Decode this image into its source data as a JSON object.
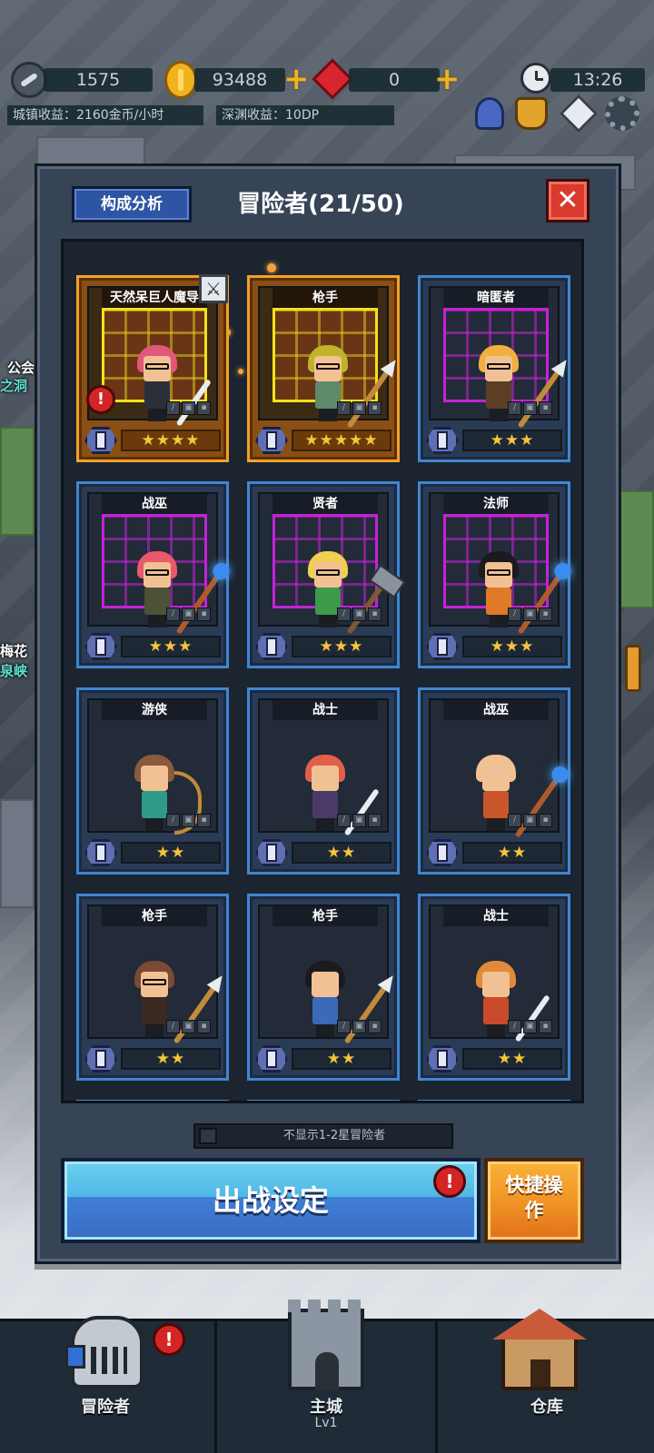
{
  "hud": {
    "emblem_value": "1575",
    "gold_value": "93488",
    "gem_value": "0",
    "clock_time": "13:26",
    "town_income": "城镇收益：2160金币/小时",
    "abyss_income": "深渊收益：10DP"
  },
  "background": {
    "label_1": "公会",
    "label_2": "之洞",
    "label_3": "梅花",
    "label_4": "泉峡"
  },
  "dialog": {
    "analysis_button": "构成分析",
    "title": "冒险者(21/50)",
    "close_symbol": "✕",
    "filter_label": "不显示1-2星冒险者",
    "sortie_button": "出战设定",
    "quick_button": "快捷操作",
    "alert_symbol": "!"
  },
  "adventurers": [
    {
      "class": "天然呆巨人魔导",
      "stars": "★★★★",
      "star_count": 4,
      "frame": "gold",
      "portrait": "purple-grid"
    },
    {
      "class": "枪手",
      "stars": "★★★★★",
      "star_count": 5,
      "frame": "gold",
      "portrait": "gold-grid"
    },
    {
      "class": "暗匿者",
      "stars": "★★★",
      "star_count": 3,
      "frame": "blue",
      "portrait": "purple-grid"
    },
    {
      "class": "战巫",
      "stars": "★★★",
      "star_count": 3,
      "frame": "blue",
      "portrait": "purple-grid"
    },
    {
      "class": "贤者",
      "stars": "★★★",
      "star_count": 3,
      "frame": "blue",
      "portrait": "purple-grid"
    },
    {
      "class": "法师",
      "stars": "★★★",
      "star_count": 3,
      "frame": "blue",
      "portrait": "purple-grid"
    },
    {
      "class": "游侠",
      "stars": "★★",
      "star_count": 2,
      "frame": "blue",
      "portrait": "none"
    },
    {
      "class": "战士",
      "stars": "★★",
      "star_count": 2,
      "frame": "blue",
      "portrait": "none"
    },
    {
      "class": "战巫",
      "stars": "★★",
      "star_count": 2,
      "frame": "blue",
      "portrait": "none"
    },
    {
      "class": "枪手",
      "stars": "★★",
      "star_count": 2,
      "frame": "blue",
      "portrait": "none"
    },
    {
      "class": "枪手",
      "stars": "★★",
      "star_count": 2,
      "frame": "blue",
      "portrait": "none"
    },
    {
      "class": "战士",
      "stars": "★★",
      "star_count": 2,
      "frame": "blue",
      "portrait": "none"
    }
  ],
  "nav": {
    "adventurers": "冒险者",
    "main_city": "主城",
    "main_city_level": "Lv1",
    "warehouse": "仓库"
  },
  "colors": {
    "panel": "#364456",
    "card_blue_border": "#3f86d1",
    "card_gold_border": "#f3a12a",
    "star": "#f5c53a",
    "alert_red": "#d42525",
    "sortie_blue": "#4fb8e6",
    "quick_orange": "#f29524"
  }
}
